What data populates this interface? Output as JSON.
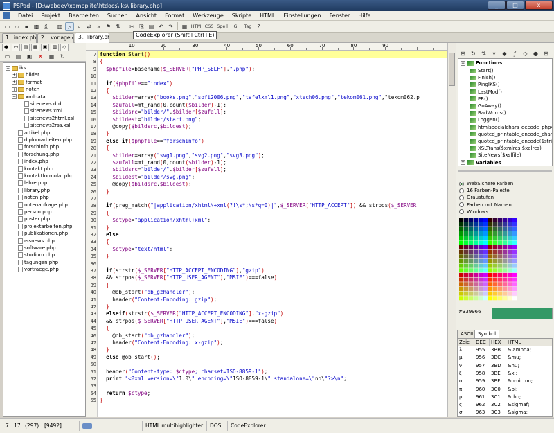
{
  "window": {
    "title": "PSPad - [D:\\webdev\\xampplite\\htdocs\\iks\\ library.php]",
    "minimize": "_",
    "maximize": "□",
    "close": "x"
  },
  "menu": [
    "Datei",
    "Projekt",
    "Bearbeiten",
    "Suchen",
    "Ansicht",
    "Format",
    "Werkzeuge",
    "Skripte",
    "HTML",
    "Einstellungen",
    "Fenster",
    "Hilfe"
  ],
  "tooltip": "CodeExplorer (Shift+Ctrl+E)",
  "toolbar_icons": [
    "new-file-icon",
    "open-icon",
    "save-icon",
    "save-all-icon",
    "print-icon",
    "project-icon",
    "code-explorer-icon",
    "search-icon",
    "replace-icon",
    "find-next-icon",
    "bookmark-icon",
    "ftp-icon",
    "cut-icon",
    "copy-icon",
    "paste-icon",
    "undo-icon",
    "redo-icon",
    "select-all-icon",
    "html-icon",
    "css-icon",
    "spell-icon",
    "google-icon",
    "help-icon"
  ],
  "toolbar_labels": {
    "spell": "Spell",
    "html": "HTM",
    "css": "CSS",
    "tag": "Tag",
    "google": "G"
  },
  "tabs": [
    "1.. index.php",
    "2... vorlage.css",
    "3.. library.php"
  ],
  "file_tree": [
    {
      "label": "iks",
      "type": "folder",
      "level": 0,
      "expanded": true
    },
    {
      "label": "bilder",
      "type": "folder",
      "level": 1,
      "expanded": false
    },
    {
      "label": "format",
      "type": "folder",
      "level": 1,
      "expanded": false
    },
    {
      "label": "noten",
      "type": "folder",
      "level": 1,
      "expanded": false
    },
    {
      "label": "xmldata",
      "type": "folder",
      "level": 1,
      "expanded": true
    },
    {
      "label": "sitenews.dtd",
      "type": "file",
      "level": 2
    },
    {
      "label": "sitenews.xml",
      "type": "file",
      "level": 2
    },
    {
      "label": "sitenews2html.xsl",
      "type": "file",
      "level": 2
    },
    {
      "label": "sitenews2rss.xsl",
      "type": "file",
      "level": 2
    },
    {
      "label": "artikel.php",
      "type": "file",
      "level": 1
    },
    {
      "label": "diplomarbeiten.php",
      "type": "file",
      "level": 1
    },
    {
      "label": "forschinfo.php",
      "type": "file",
      "level": 1
    },
    {
      "label": "forschung.php",
      "type": "file",
      "level": 1
    },
    {
      "label": "index.php",
      "type": "file",
      "level": 1
    },
    {
      "label": "kontakt.php",
      "type": "file",
      "level": 1
    },
    {
      "label": "kontaktformular.php",
      "type": "file",
      "level": 1
    },
    {
      "label": "lehre.php",
      "type": "file",
      "level": 1
    },
    {
      "label": "library.php",
      "type": "file",
      "level": 1
    },
    {
      "label": "noten.php",
      "type": "file",
      "level": 1
    },
    {
      "label": "notenabfrage.php",
      "type": "file",
      "level": 1
    },
    {
      "label": "person.php",
      "type": "file",
      "level": 1
    },
    {
      "label": "poster.php",
      "type": "file",
      "level": 1
    },
    {
      "label": "projektarbeiten.php",
      "type": "file",
      "level": 1
    },
    {
      "label": "publikationen.php",
      "type": "file",
      "level": 1
    },
    {
      "label": "rssnews.php",
      "type": "file",
      "level": 1
    },
    {
      "label": "software.php",
      "type": "file",
      "level": 1
    },
    {
      "label": "studium.php",
      "type": "file",
      "level": 1
    },
    {
      "label": "tagungen.php",
      "type": "file",
      "level": 1
    },
    {
      "label": "vortraege.php",
      "type": "file",
      "level": 1
    }
  ],
  "ruler": [
    "10",
    "20",
    "30",
    "40",
    "50",
    "60",
    "70",
    "80",
    "90"
  ],
  "code_lines": [
    {
      "n": "7",
      "t": "function Start()",
      "hl": true
    },
    {
      "n": "8",
      "t": "{"
    },
    {
      "n": "9",
      "t": "  $phpfile=basename($_SERVER[\"PHP_SELF\"],\".php\");"
    },
    {
      "n": "10",
      "t": ""
    },
    {
      "n": "11",
      "t": "  if($phpfile==\"index\")"
    },
    {
      "n": "12",
      "t": "  {"
    },
    {
      "n": "13",
      "t": "    $bilder=array(\"books.png\",\"sofi2006.png\",\"tafelxml1.png\",\"xtech06.png\",\"tekom061.png\",\"tekom062.p"
    },
    {
      "n": "14",
      "t": "    $zufall=mt_rand(0,count($bilder)-1);"
    },
    {
      "n": "15",
      "t": "    $bildsrc=\"bilder/\".$bilder[$zufall];"
    },
    {
      "n": "16",
      "t": "    $bildest=\"bilder/start.png\";"
    },
    {
      "n": "17",
      "t": "    @copy($bildsrc,$bildest);"
    },
    {
      "n": "18",
      "t": "  }"
    },
    {
      "n": "19",
      "t": "  else if($phpfile==\"forschinfo\")"
    },
    {
      "n": "20",
      "t": "  {"
    },
    {
      "n": "21",
      "t": "    $bilder=array(\"svg1.png\",\"svg2.png\",\"svg3.png\");"
    },
    {
      "n": "22",
      "t": "    $zufall=mt_rand(0,count($bilder)-1);"
    },
    {
      "n": "23",
      "t": "    $bildsrc=\"bilder/\".$bilder[$zufall];"
    },
    {
      "n": "24",
      "t": "    $bildest=\"bilder/svg.png\";"
    },
    {
      "n": "25",
      "t": "    @copy($bildsrc,$bildest);"
    },
    {
      "n": "26",
      "t": "  }"
    },
    {
      "n": "27",
      "t": ""
    },
    {
      "n": "28",
      "t": "  if(preg_match(\"|application/xhtml\\+xml(?!\\s*;\\s*q=0)|\",$_SERVER[\"HTTP_ACCEPT\"]) && strpos($_SERVER"
    },
    {
      "n": "29",
      "t": "  {"
    },
    {
      "n": "30",
      "t": "    $ctype=\"application/xhtml+xml\";"
    },
    {
      "n": "31",
      "t": "  }"
    },
    {
      "n": "32",
      "t": "  else"
    },
    {
      "n": "33",
      "t": "  {"
    },
    {
      "n": "34",
      "t": "    $ctype=\"text/html\";"
    },
    {
      "n": "35",
      "t": "  }"
    },
    {
      "n": "36",
      "t": ""
    },
    {
      "n": "37",
      "t": "  if(strstr($_SERVER[\"HTTP_ACCEPT_ENCODING\"],\"gzip\")"
    },
    {
      "n": "38",
      "t": "  && strpos($_SERVER[\"HTTP_USER_AGENT\"],\"MSIE\")===false)"
    },
    {
      "n": "39",
      "t": "  {"
    },
    {
      "n": "40",
      "t": "    @ob_start(\"ob_gzhandler\");"
    },
    {
      "n": "41",
      "t": "    header(\"Content-Encoding: gzip\");"
    },
    {
      "n": "42",
      "t": "  }"
    },
    {
      "n": "43",
      "t": "  elseif(strstr($_SERVER[\"HTTP_ACCEPT_ENCODING\"],\"x-gzip\")"
    },
    {
      "n": "44",
      "t": "  && strpos($_SERVER[\"HTTP_USER_AGENT\"],\"MSIE\")===false)"
    },
    {
      "n": "45",
      "t": "  {"
    },
    {
      "n": "46",
      "t": "    @ob_start(\"ob_gzhandler\");"
    },
    {
      "n": "47",
      "t": "    header(\"Content-Encoding: x-gzip\");"
    },
    {
      "n": "48",
      "t": "  }"
    },
    {
      "n": "49",
      "t": "  else @ob_start();"
    },
    {
      "n": "50",
      "t": ""
    },
    {
      "n": "51",
      "t": "  header(\"Content-type: $ctype; charset=ISO-8859-1\");"
    },
    {
      "n": "52",
      "t": "  print \"<?xml version=\\\"1.0\\\" encoding=\\\"ISO-8859-1\\\" standalone=\\\"no\\\"?>\\n\";"
    },
    {
      "n": "53",
      "t": ""
    },
    {
      "n": "54",
      "t": "  return $ctype;"
    },
    {
      "n": "55",
      "t": "}"
    }
  ],
  "code_explorer": {
    "functions_label": "Functions",
    "functions": [
      "Start()",
      "Finish()",
      "PingIKS()",
      "LastMod()",
      "PR()",
      "GoAway()",
      "BadWords()",
      "Loggen()",
      "htmlspecialchars_decode_php4(",
      "quoted_printable_encode_charac",
      "quoted_printable_encode($string",
      "XSLTrans($xmlres,$xalres)",
      "SiteNews($xslfile)"
    ],
    "variables_label": "Variables"
  },
  "color_options": [
    "WebSichere Farben",
    "16 Farben-Palette",
    "Graustufen",
    "Farben mit Namen",
    "Windows"
  ],
  "color_selected": 0,
  "color_hex": "#339966",
  "color_value": "#339966",
  "ascii_tabs": [
    "ASCII",
    "Symbol"
  ],
  "ascii_headers": [
    "Zeic",
    "DEC",
    "HEX",
    "HTML"
  ],
  "ascii_rows": [
    [
      "λ",
      "955",
      "3BB",
      "&lambda;"
    ],
    [
      "μ",
      "956",
      "3BC",
      "&mu;"
    ],
    [
      "ν",
      "957",
      "3BD",
      "&nu;"
    ],
    [
      "ξ",
      "958",
      "3BE",
      "&xi;"
    ],
    [
      "ο",
      "959",
      "3BF",
      "&omicron;"
    ],
    [
      "π",
      "960",
      "3C0",
      "&pi;"
    ],
    [
      "ρ",
      "961",
      "3C1",
      "&rho;"
    ],
    [
      "ς",
      "962",
      "3C2",
      "&sigmaf;"
    ],
    [
      "σ",
      "963",
      "3C3",
      "&sigma;"
    ]
  ],
  "status": {
    "position": "7 : 17",
    "lines": "(297)",
    "size": "[9492]",
    "highlighter": "HTML multihighlighter",
    "format": "DOS",
    "panel": "CodeExplorer"
  }
}
